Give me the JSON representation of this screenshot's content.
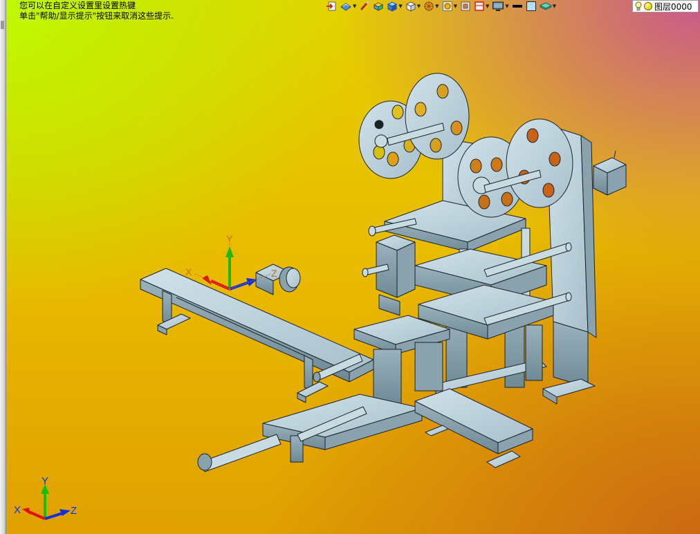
{
  "hints": {
    "line1": "您可以在自定义设置里设置热键",
    "line2": "单击\"帮助/显示提示\"按钮来取消这些提示."
  },
  "toolbar": {
    "items": [
      {
        "icon": "exit-view-icon",
        "has_dropdown": false
      },
      {
        "icon": "render-mode-icon",
        "has_dropdown": true
      },
      {
        "icon": "brush-icon",
        "has_dropdown": false
      },
      {
        "icon": "shaded-block-icon",
        "has_dropdown": false
      },
      {
        "icon": "cube-view-icon",
        "has_dropdown": true
      },
      {
        "icon": "white-cube-icon",
        "has_dropdown": true
      },
      {
        "icon": "orange-disc-icon",
        "has_dropdown": true
      },
      {
        "icon": "gear-frame-icon",
        "has_dropdown": true
      },
      {
        "icon": "frame-panel-icon",
        "has_dropdown": false
      },
      {
        "icon": "red-frame-icon",
        "has_dropdown": true
      },
      {
        "icon": "monitor-icon",
        "has_dropdown": true
      },
      {
        "icon": "line-color-icon",
        "has_dropdown": false
      },
      {
        "icon": "fill-color-icon",
        "has_dropdown": false
      },
      {
        "icon": "layer-plane-icon",
        "has_dropdown": true
      }
    ]
  },
  "layer": {
    "label": "图层0000",
    "colors": {
      "bulb": "#fff7a0",
      "dot": "#e8d000"
    }
  },
  "axes_model": {
    "x": "X",
    "y": "Y",
    "z": "Z"
  },
  "axes_triad": {
    "x": "X",
    "y": "Y",
    "z": "Z"
  },
  "colors": {
    "part": "#b8cfd8",
    "part_shadow": "#8fa8b4",
    "part_dark": "#6d8794",
    "edge": "#1a2226",
    "axis_x": "#e01010",
    "axis_y": "#10c010",
    "axis_z": "#1030e0"
  }
}
